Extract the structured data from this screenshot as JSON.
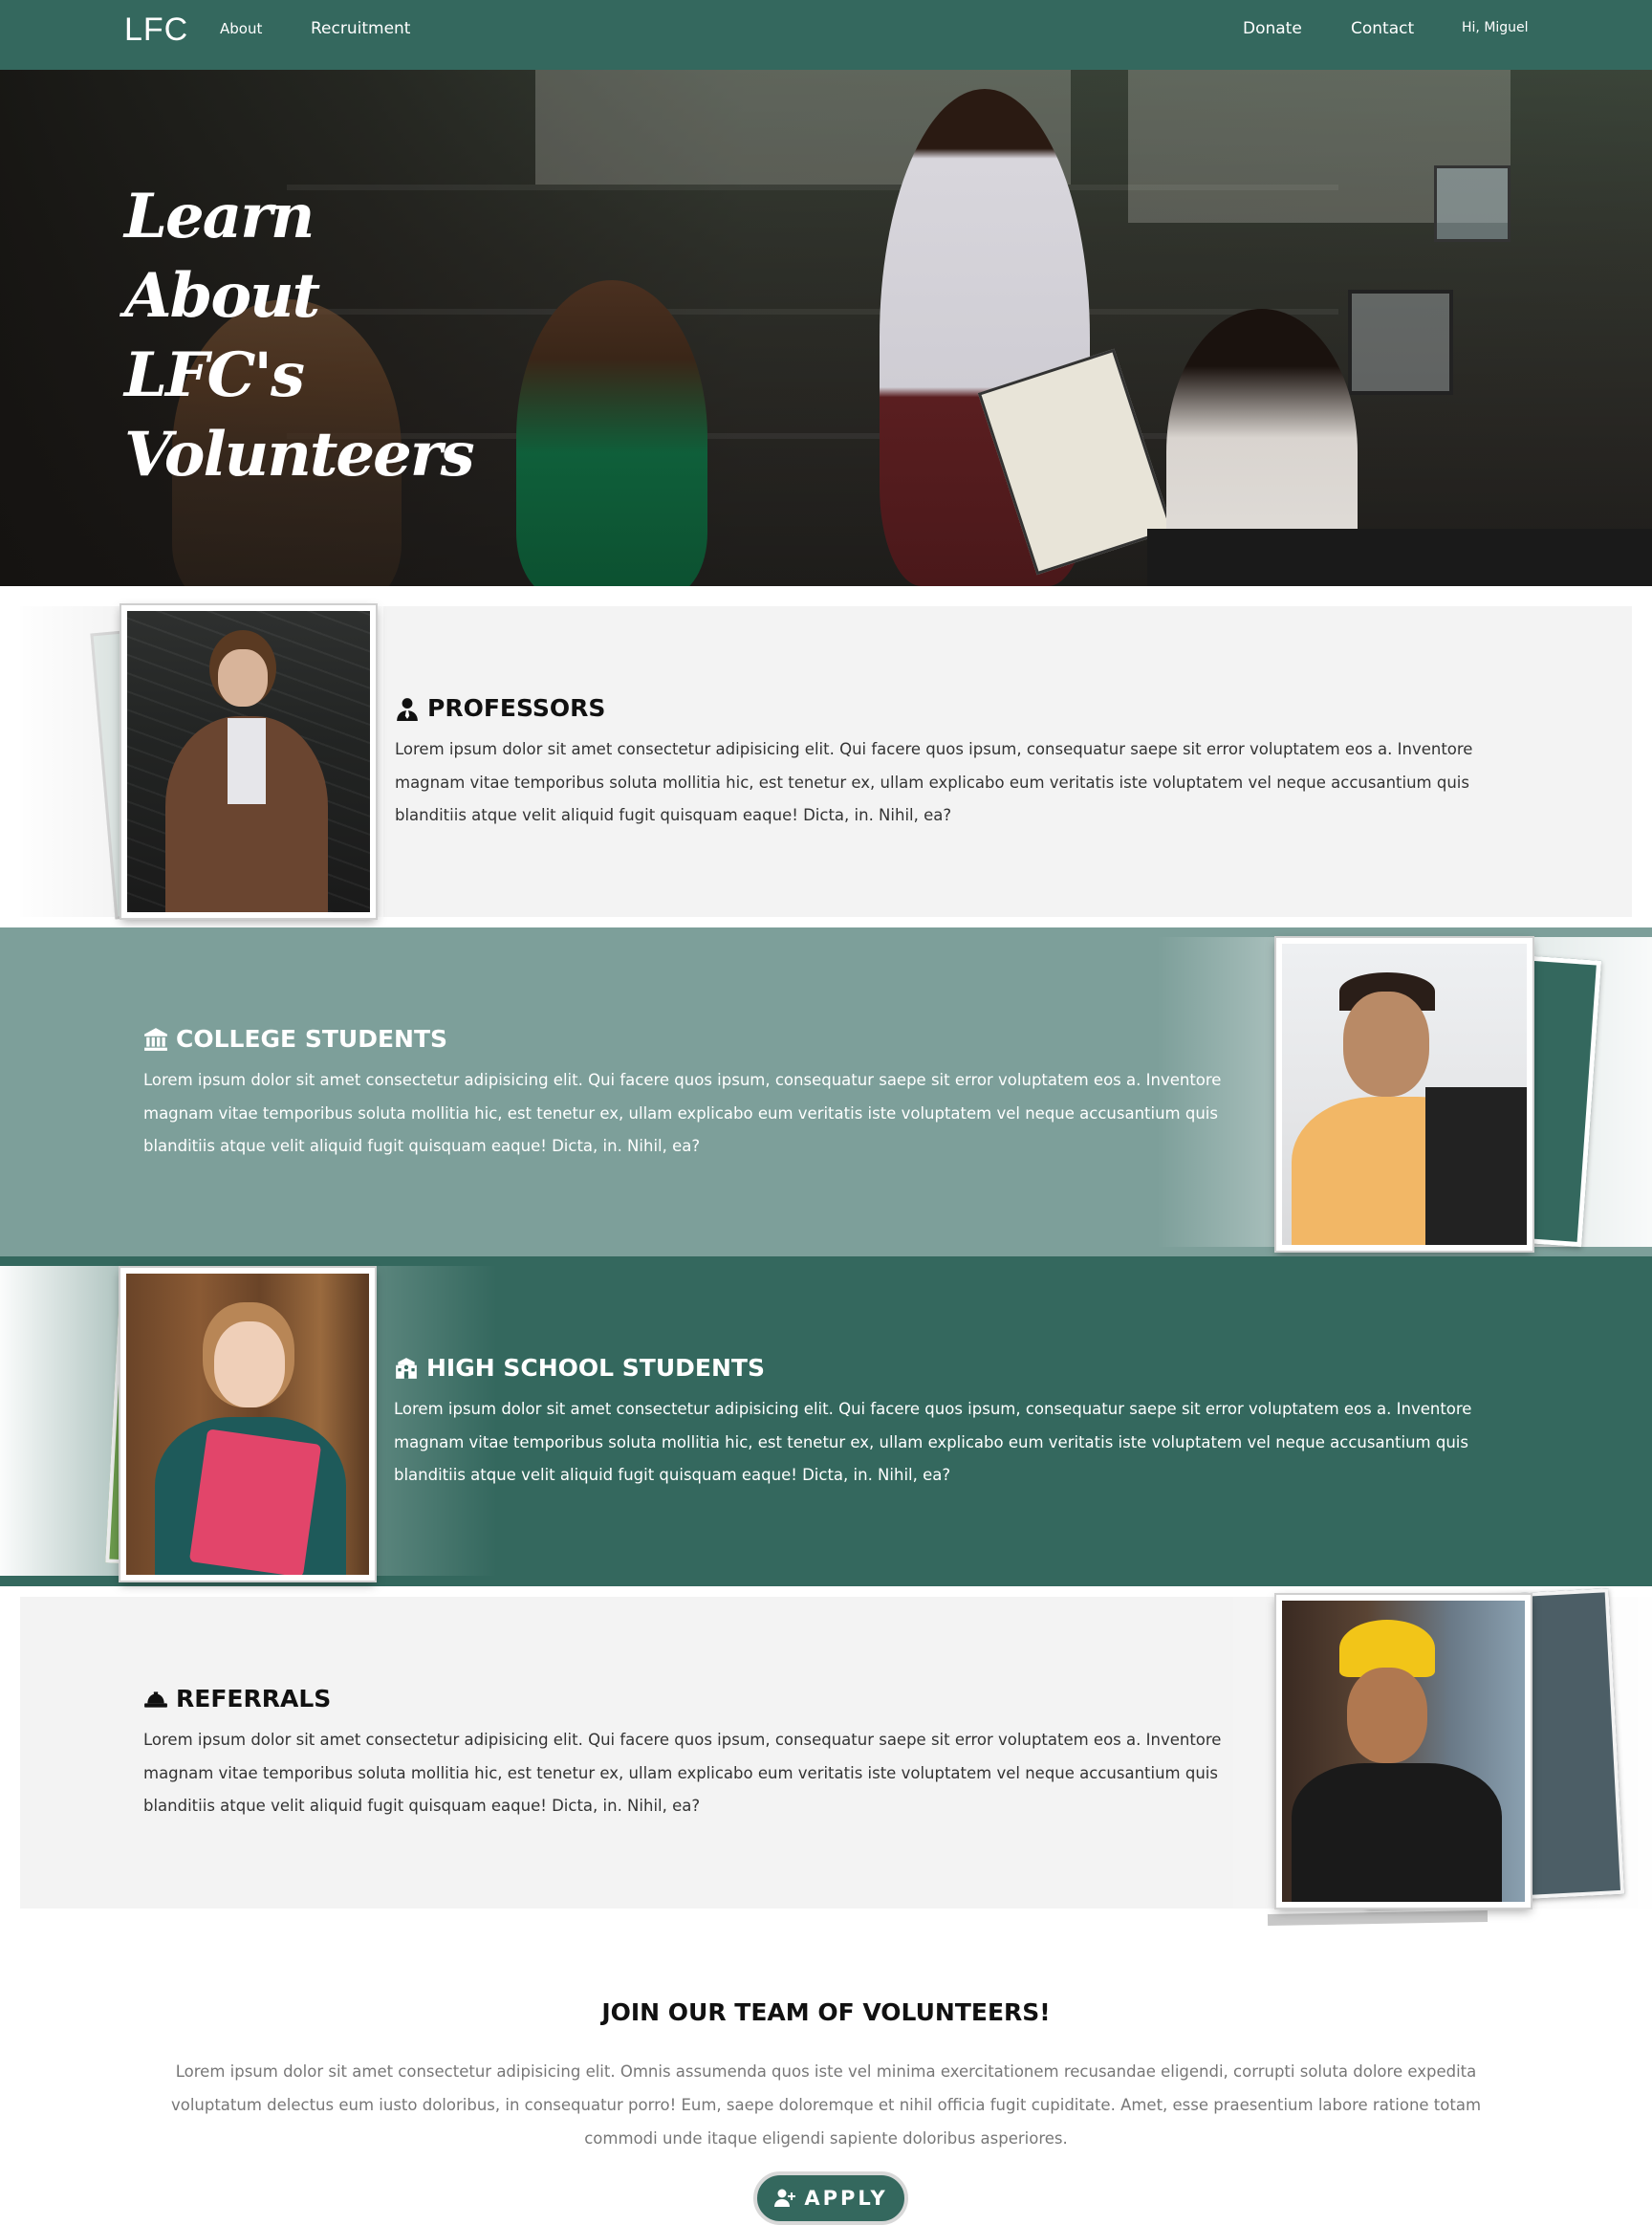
{
  "nav": {
    "logo": "LFC",
    "about": "About",
    "recruitment": "Recruitment",
    "donate": "Donate",
    "contact": "Contact",
    "user": "Hi, Miguel",
    "color": "#34685e"
  },
  "hero": {
    "title": "Learn About LFC's Volunteers"
  },
  "sections": [
    {
      "icon": "user-tie-icon",
      "title": "PROFESSORS",
      "text": "Lorem ipsum dolor sit amet consectetur adipisicing elit. Qui facere quos ipsum, consequatur saepe sit error voluptatem eos a. Inventore magnam vitae temporibus soluta mollitia hic, est tenetur ex, ullam explicabo eum veritatis iste voluptatem vel neque accusantium quis blanditiis atque velit aliquid fugit quisquam eaque! Dicta, in. Nihil, ea?",
      "bg": "#f3f3f3"
    },
    {
      "icon": "university-icon",
      "title": "COLLEGE STUDENTS",
      "text": "Lorem ipsum dolor sit amet consectetur adipisicing elit. Qui facere quos ipsum, consequatur saepe sit error voluptatem eos a. Inventore magnam vitae temporibus soluta mollitia hic, est tenetur ex, ullam explicabo eum veritatis iste voluptatem vel neque accusantium quis blanditiis atque velit aliquid fugit quisquam eaque! Dicta, in. Nihil, ea?",
      "bg": "#7d9f9a"
    },
    {
      "icon": "school-icon",
      "title": "HIGH SCHOOL STUDENTS",
      "text": "Lorem ipsum dolor sit amet consectetur adipisicing elit. Qui facere quos ipsum, consequatur saepe sit error voluptatem eos a. Inventore magnam vitae temporibus soluta mollitia hic, est tenetur ex, ullam explicabo eum veritatis iste voluptatem vel neque accusantium quis blanditiis atque velit aliquid fugit quisquam eaque! Dicta, in. Nihil, ea?",
      "bg": "#34685e"
    },
    {
      "icon": "hard-hat-icon",
      "title": "REFERRALS",
      "text": "Lorem ipsum dolor sit amet consectetur adipisicing elit. Qui facere quos ipsum, consequatur saepe sit error voluptatem eos a. Inventore magnam vitae temporibus soluta mollitia hic, est tenetur ex, ullam explicabo eum veritatis iste voluptatem vel neque accusantium quis blanditiis atque velit aliquid fugit quisquam eaque! Dicta, in. Nihil, ea?",
      "bg": "#f3f3f3"
    }
  ],
  "join": {
    "title": "JOIN OUR TEAM OF VOLUNTEERS!",
    "text": "Lorem ipsum dolor sit amet consectetur adipisicing elit. Omnis assumenda quos iste vel minima exercitationem recusandae eligendi, corrupti soluta dolore expedita voluptatum delectus eum iusto doloribus, in consequatur porro! Eum, saepe doloremque et nihil officia fugit cupiditate. Amet, esse praesentium labore ratione totam commodi unde itaque eligendi sapiente doloribus asperiores.",
    "apply_label": "APPLY"
  }
}
